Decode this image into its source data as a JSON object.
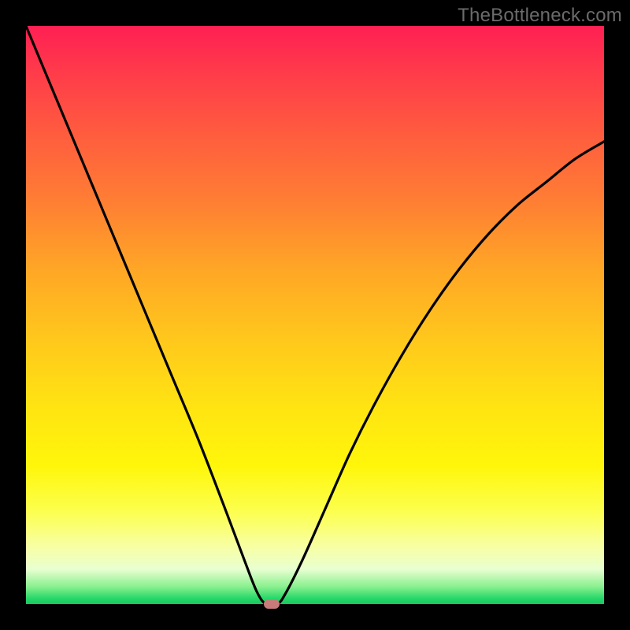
{
  "watermark": "TheBottleneck.com",
  "chart_data": {
    "type": "line",
    "title": "",
    "xlabel": "",
    "ylabel": "",
    "xlim": [
      0,
      100
    ],
    "ylim": [
      0,
      100
    ],
    "series": [
      {
        "name": "bottleneck-curve",
        "x": [
          0,
          5,
          10,
          15,
          20,
          25,
          30,
          35,
          38,
          40,
          41.5,
          43.5,
          45,
          48,
          52,
          56,
          60,
          65,
          70,
          75,
          80,
          85,
          90,
          95,
          100
        ],
        "values": [
          100,
          88,
          76,
          64,
          52,
          40,
          28,
          15,
          7,
          2,
          0,
          0,
          2,
          8,
          17,
          26,
          34,
          43,
          51,
          58,
          64,
          69,
          73,
          77,
          80
        ]
      }
    ],
    "marker": {
      "x": 42.5,
      "y": 0
    },
    "gradient_bands": [
      "#ff1f53",
      "#ff5a3f",
      "#ffa626",
      "#ffe412",
      "#fcff4e",
      "#e8ffd0",
      "#28d86a"
    ]
  }
}
